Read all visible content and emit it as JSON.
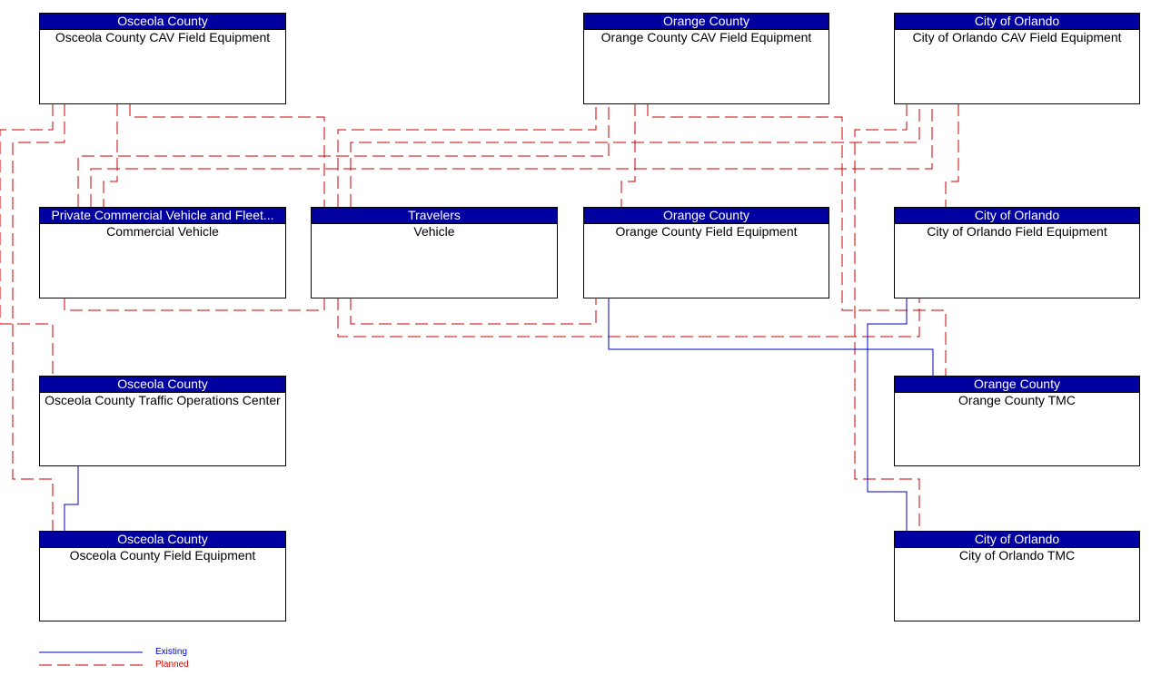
{
  "colors": {
    "existing": "#0000cc",
    "planned": "#cc0000",
    "header": "#0000a0"
  },
  "boxes": [
    {
      "id": "osc-cav",
      "owner": "Osceola County",
      "name": "Osceola County CAV Field Equipment"
    },
    {
      "id": "oc-cav",
      "owner": "Orange County",
      "name": "Orange County CAV Field Equipment"
    },
    {
      "id": "coo-cav",
      "owner": "City of Orlando",
      "name": "City of Orlando CAV Field Equipment"
    },
    {
      "id": "cv",
      "owner": "Private Commercial Vehicle and Fleet...",
      "name": "Commercial Vehicle"
    },
    {
      "id": "trav",
      "owner": "Travelers",
      "name": "Vehicle"
    },
    {
      "id": "ocfe",
      "owner": "Orange County",
      "name": "Orange County Field Equipment"
    },
    {
      "id": "coofe",
      "owner": "City of Orlando",
      "name": "City of Orlando Field Equipment"
    },
    {
      "id": "osctoc",
      "owner": "Osceola County",
      "name": "Osceola County Traffic Operations Center"
    },
    {
      "id": "octmc",
      "owner": "Orange County",
      "name": "Orange County TMC"
    },
    {
      "id": "oscfe",
      "owner": "Osceola County",
      "name": "Osceola County Field Equipment"
    },
    {
      "id": "cootmc",
      "owner": "City of Orlando",
      "name": "City of Orlando TMC"
    }
  ],
  "legend": {
    "existing": "Existing",
    "planned": "Planned"
  }
}
